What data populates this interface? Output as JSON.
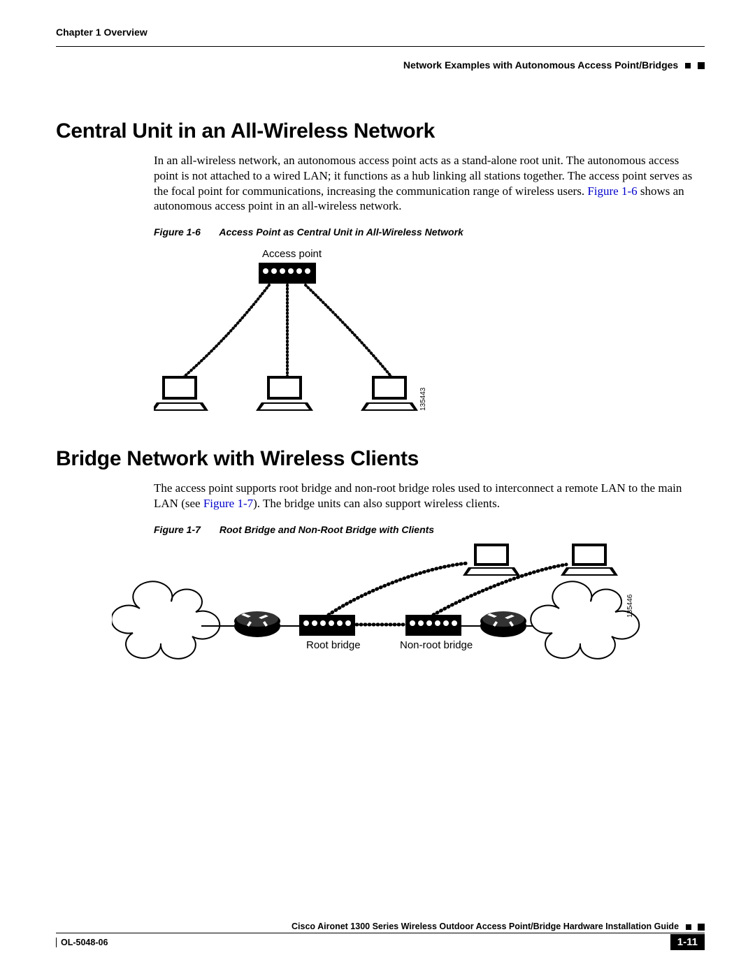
{
  "header": {
    "chapter": "Chapter 1      Overview",
    "section": "Network Examples with Autonomous Access Point/Bridges"
  },
  "section1": {
    "heading": "Central Unit in an All-Wireless Network",
    "body_a": "In an all-wireless network, an autonomous access point acts as a stand-alone root unit. The autonomous access point is not attached to a wired LAN; it functions as a hub linking all stations together. The access point serves as the focal point for communications, increasing the communication range of wireless users. ",
    "figure_ref": "Figure 1-6",
    "body_b": " shows an autonomous access point in an all-wireless network.",
    "figure_label": "Figure 1-6",
    "figure_title": "Access Point as Central Unit in All-Wireless Network",
    "diagram": {
      "ap_label": "Access point",
      "image_number": "135443"
    }
  },
  "section2": {
    "heading": "Bridge Network with Wireless Clients",
    "body_a": "The access point supports root bridge and non-root bridge roles used to interconnect a remote LAN to the main LAN (see ",
    "figure_ref": "Figure 1-7",
    "body_b": "). The bridge units can also support wireless clients.",
    "figure_label": "Figure 1-7",
    "figure_title": "Root Bridge and Non-Root Bridge with Clients",
    "diagram": {
      "root_label": "Root bridge",
      "nonroot_label": "Non-root bridge",
      "image_number": "135446"
    }
  },
  "footer": {
    "guide": "Cisco Aironet 1300 Series Wireless Outdoor Access Point/Bridge Hardware Installation Guide",
    "doc_id": "OL-5048-06",
    "page_num": "1-11"
  }
}
